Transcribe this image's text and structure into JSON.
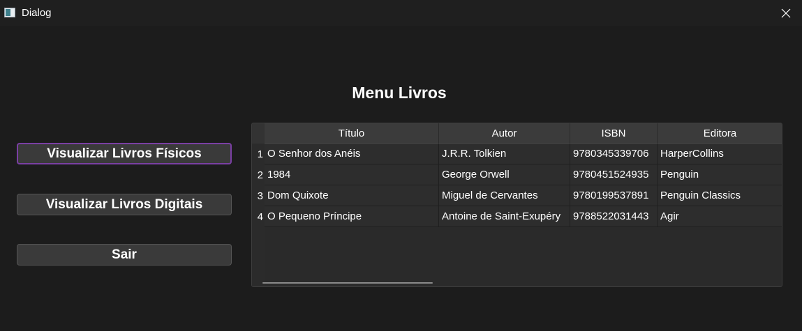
{
  "window": {
    "title": "Dialog",
    "icon": "window-app-icon",
    "close_icon": "close-icon"
  },
  "main": {
    "heading": "Menu Livros"
  },
  "buttons": {
    "physical": "Visualizar Livros Físicos",
    "digital": "Visualizar Livros Digitais",
    "exit": "Sair"
  },
  "table": {
    "headers": [
      "Título",
      "Autor",
      "ISBN",
      "Editora"
    ],
    "row_numbers": [
      "1",
      "2",
      "3",
      "4"
    ],
    "rows": [
      [
        "O Senhor dos Anéis",
        "J.R.R. Tolkien",
        "9780345339706",
        "HarperCollins"
      ],
      [
        "1984",
        "George Orwell",
        "9780451524935",
        "Penguin"
      ],
      [
        "Dom Quixote",
        "Miguel de Cervantes",
        "9780199537891",
        "Penguin Classics"
      ],
      [
        "O Pequeno Príncipe",
        "Antoine de Saint-Exupéry",
        "9788522031443",
        "Agir"
      ]
    ]
  },
  "colors": {
    "background": "#1c1c1c",
    "button": "#3a3a3a",
    "focus_border": "#7a3fa3",
    "header": "#3b3b3b",
    "cell": "#2d2d2d"
  }
}
